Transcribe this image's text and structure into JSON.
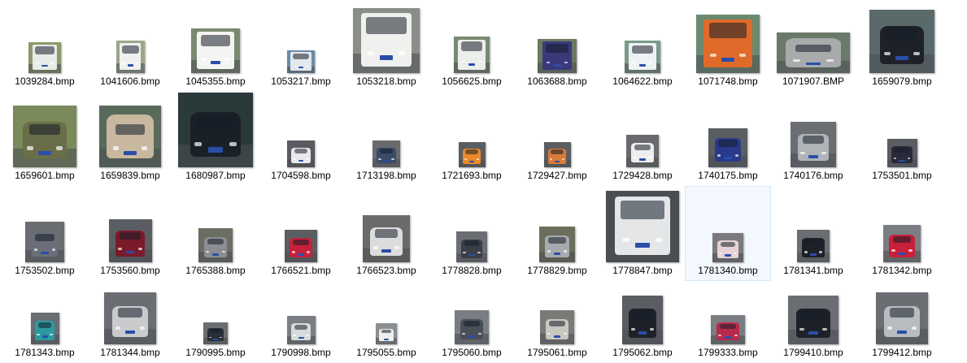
{
  "files": [
    {
      "name": "1039284.bmp",
      "color": "#e8ece8",
      "bg": "#8a9a6a",
      "kind": "truck"
    },
    {
      "name": "1041606.bmp",
      "color": "#f0f0ee",
      "bg": "#9aa88a",
      "kind": "truck"
    },
    {
      "name": "1045355.bmp",
      "color": "#f4f4f2",
      "bg": "#7a8a70",
      "kind": "truck"
    },
    {
      "name": "1053217.bmp",
      "color": "#e4e8ec",
      "bg": "#6a8aa8",
      "kind": "truck"
    },
    {
      "name": "1053218.bmp",
      "color": "#f0f0ee",
      "bg": "#8a8e88",
      "kind": "truck"
    },
    {
      "name": "1056625.bmp",
      "color": "#eceeec",
      "bg": "#7a8a70",
      "kind": "truck"
    },
    {
      "name": "1063688.bmp",
      "color": "#3a3a7a",
      "bg": "#6a7a60",
      "kind": "truck"
    },
    {
      "name": "1064622.bmp",
      "color": "#eef2f4",
      "bg": "#7a9a8a",
      "kind": "truck"
    },
    {
      "name": "1071748.bmp",
      "color": "#e06a2a",
      "bg": "#6a8a70",
      "kind": "truck"
    },
    {
      "name": "1071907.BMP",
      "color": "#a8aaac",
      "bg": "#6a7a68",
      "kind": "van"
    },
    {
      "name": "1659079.bmp",
      "color": "#1e2228",
      "bg": "#5a6a6a",
      "kind": "car"
    },
    {
      "name": "1659601.bmp",
      "color": "#6a6e48",
      "bg": "#7a8a5a",
      "kind": "car"
    },
    {
      "name": "1659839.bmp",
      "color": "#c8b8a0",
      "bg": "#5a6a5a",
      "kind": "van"
    },
    {
      "name": "1680987.bmp",
      "color": "#1a2028",
      "bg": "#2a3a3a",
      "kind": "car"
    },
    {
      "name": "1704598.bmp",
      "color": "#e8e8ec",
      "bg": "#5a5a60",
      "kind": "car"
    },
    {
      "name": "1713198.bmp",
      "color": "#3a4a6a",
      "bg": "#6a6a6e",
      "kind": "car"
    },
    {
      "name": "1721693.bmp",
      "color": "#e88a2a",
      "bg": "#5a5e62",
      "kind": "car"
    },
    {
      "name": "1729427.bmp",
      "color": "#d87a3a",
      "bg": "#5a5e62",
      "kind": "car"
    },
    {
      "name": "1729428.bmp",
      "color": "#eeeeee",
      "bg": "#6a6a6e",
      "kind": "car"
    },
    {
      "name": "1740175.bmp",
      "color": "#2a3a8a",
      "bg": "#5a5e62",
      "kind": "car"
    },
    {
      "name": "1740176.bmp",
      "color": "#b0b4b8",
      "bg": "#6a6e72",
      "kind": "car"
    },
    {
      "name": "1753501.bmp",
      "color": "#2a2a3a",
      "bg": "#5a5e62",
      "kind": "car"
    },
    {
      "name": "1753502.bmp",
      "color": "#6a6e78",
      "bg": "#6a6e72",
      "kind": "car"
    },
    {
      "name": "1753560.bmp",
      "color": "#7a1a2a",
      "bg": "#5a5e62",
      "kind": "car"
    },
    {
      "name": "1765388.bmp",
      "color": "#8a8e92",
      "bg": "#6a6e62",
      "kind": "car"
    },
    {
      "name": "1766521.bmp",
      "color": "#c8203a",
      "bg": "#5a5e62",
      "kind": "car"
    },
    {
      "name": "1766523.bmp",
      "color": "#dcdcdc",
      "bg": "#6a6a6a",
      "kind": "car"
    },
    {
      "name": "1778828.bmp",
      "color": "#3a3e48",
      "bg": "#6a6e72",
      "kind": "car"
    },
    {
      "name": "1778829.bmp",
      "color": "#a8aab0",
      "bg": "#6a6e5a",
      "kind": "car"
    },
    {
      "name": "1778847.bmp",
      "color": "#e4e6e8",
      "bg": "#4a4e52",
      "kind": "bus"
    },
    {
      "name": "1781340.bmp",
      "color": "#e6d2d6",
      "bg": "#7a7a7e",
      "kind": "car"
    },
    {
      "name": "1781341.bmp",
      "color": "#1e2228",
      "bg": "#6a6e72",
      "kind": "car"
    },
    {
      "name": "1781342.bmp",
      "color": "#c8203a",
      "bg": "#7a7e82",
      "kind": "car"
    },
    {
      "name": "1781343.bmp",
      "color": "#2a9aa0",
      "bg": "#6a6e72",
      "kind": "car"
    },
    {
      "name": "1781344.bmp",
      "color": "#c8cacc",
      "bg": "#6a6e72",
      "kind": "car"
    },
    {
      "name": "1790995.bmp",
      "color": "#2a2e38",
      "bg": "#6a6e72",
      "kind": "car"
    },
    {
      "name": "1790998.bmp",
      "color": "#d8dadc",
      "bg": "#7a7e82",
      "kind": "car"
    },
    {
      "name": "1795055.bmp",
      "color": "#eeeeee",
      "bg": "#8a8e92",
      "kind": "car"
    },
    {
      "name": "1795060.bmp",
      "color": "#4a4e58",
      "bg": "#7a7e82",
      "kind": "car"
    },
    {
      "name": "1795061.bmp",
      "color": "#c8c8c0",
      "bg": "#7a7a78",
      "kind": "car"
    },
    {
      "name": "1795062.bmp",
      "color": "#1e2228",
      "bg": "#5a5e62",
      "kind": "car"
    },
    {
      "name": "1799333.bmp",
      "color": "#b82a4a",
      "bg": "#7a7e82",
      "kind": "car"
    },
    {
      "name": "1799410.bmp",
      "color": "#1e2228",
      "bg": "#6a6e72",
      "kind": "car"
    },
    {
      "name": "1799412.bmp",
      "color": "#b8bcc0",
      "bg": "#6a6e72",
      "kind": "car"
    }
  ],
  "selected_file": "1781340.bmp"
}
